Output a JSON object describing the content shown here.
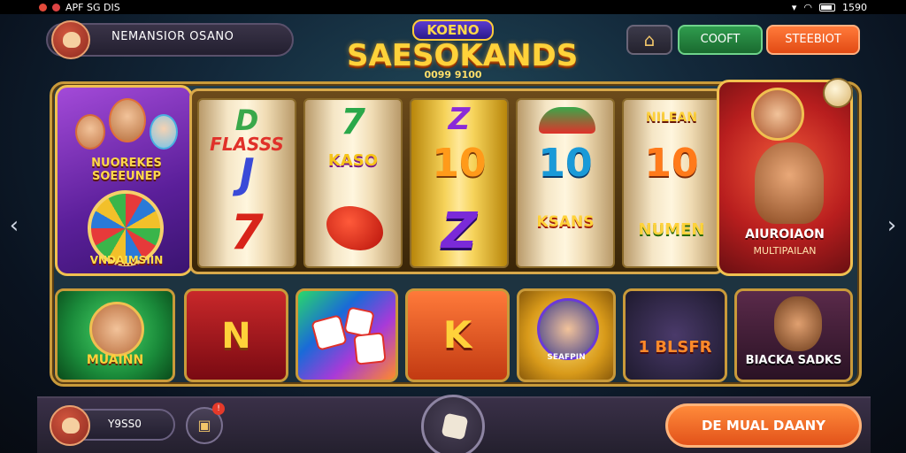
{
  "status_bar": {
    "left_text": "APF SG DIS",
    "time": "1590"
  },
  "topbar": {
    "player_name": "NEMANSIOR OSANO",
    "home_icon": "home-icon",
    "green_button": "COOFT",
    "orange_button": "STEEBIOT"
  },
  "logo": {
    "top": "KOENO",
    "main": "SAESOKANDS",
    "sub": "0099 9100"
  },
  "promo_left": {
    "title": "NUOREKES SOEEUNEP",
    "bottom": "VNDAIMSIIN"
  },
  "reels": [
    {
      "top": "D",
      "mid": "FLASSS",
      "bottom": "7"
    },
    {
      "top": "7",
      "mid": "KASO",
      "bottom": "chili"
    },
    {
      "top": "Z",
      "mid": "10",
      "bottom": "Z"
    },
    {
      "top": "watermelon",
      "mid": "10",
      "bottom": "KSANS"
    },
    {
      "top": "NILEAN",
      "mid": "10",
      "bottom": "NUMEN"
    }
  ],
  "promo_right": {
    "title": "AIUROIAON",
    "sub": "MULTIPAILAN"
  },
  "tiles": [
    {
      "label": "MUAINN",
      "theme": "green"
    },
    {
      "label": "N",
      "theme": "red"
    },
    {
      "label": "",
      "theme": "rainbow-dice"
    },
    {
      "label": "K",
      "theme": "orange"
    },
    {
      "label": "SEAFPIN",
      "theme": "gold"
    },
    {
      "label": "1 BLSFR",
      "theme": "dark"
    },
    {
      "label": "BIACKA SADKS",
      "theme": "purple"
    }
  ],
  "bottombar": {
    "balance": "Y9SS0",
    "notification_count": "!",
    "cta_label": "DE MUAL DAANY"
  }
}
